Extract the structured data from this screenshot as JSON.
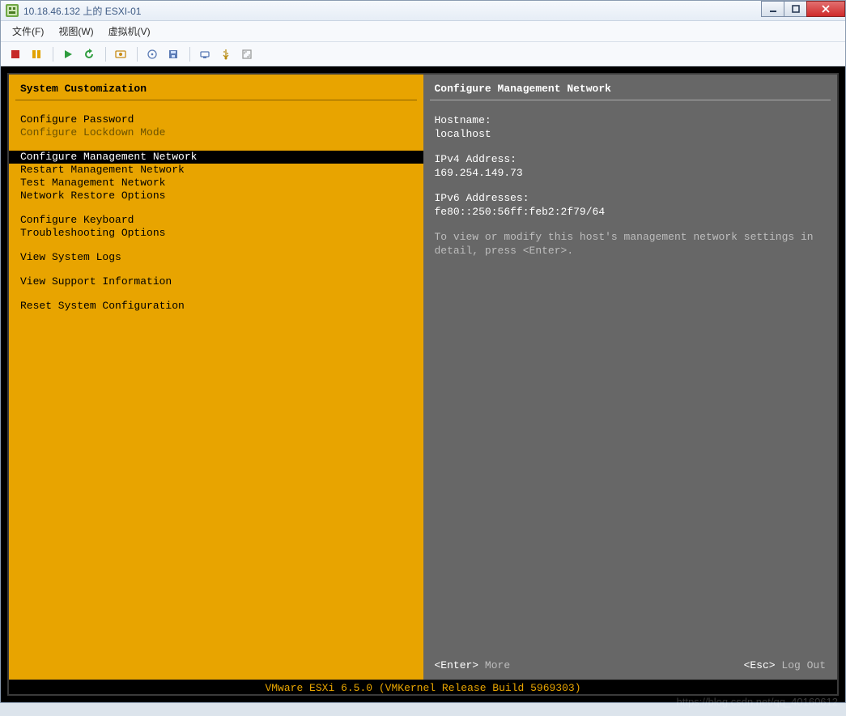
{
  "titlebar": {
    "title": "10.18.46.132 上的 ESXI-01"
  },
  "menubar": {
    "items": [
      "文件(F)",
      "视图(W)",
      "虚拟机(V)"
    ]
  },
  "toolbar": {
    "buttons": [
      "stop-icon",
      "pause-icon",
      "play-icon",
      "refresh-icon",
      "screenshot-icon",
      "cd-icon",
      "floppy-icon",
      "nic-icon",
      "usb-icon",
      "fullscreen-icon"
    ]
  },
  "left": {
    "title": "System Customization",
    "groups": [
      {
        "items": [
          {
            "label": "Configure Password",
            "state": "normal"
          },
          {
            "label": "Configure Lockdown Mode",
            "state": "disabled"
          }
        ]
      },
      {
        "items": [
          {
            "label": "Configure Management Network",
            "state": "selected"
          },
          {
            "label": "Restart Management Network",
            "state": "normal"
          },
          {
            "label": "Test Management Network",
            "state": "normal"
          },
          {
            "label": "Network Restore Options",
            "state": "normal"
          }
        ]
      },
      {
        "items": [
          {
            "label": "Configure Keyboard",
            "state": "normal"
          },
          {
            "label": "Troubleshooting Options",
            "state": "normal"
          }
        ]
      },
      {
        "items": [
          {
            "label": "View System Logs",
            "state": "normal"
          }
        ]
      },
      {
        "items": [
          {
            "label": "View Support Information",
            "state": "normal"
          }
        ]
      },
      {
        "items": [
          {
            "label": "Reset System Configuration",
            "state": "normal"
          }
        ]
      }
    ]
  },
  "right": {
    "title": "Configure Management Network",
    "hostname_label": "Hostname:",
    "hostname_value": "localhost",
    "ipv4_label": "IPv4 Address:",
    "ipv4_value": "169.254.149.73",
    "ipv6_label": "IPv6 Addresses:",
    "ipv6_value": "fe80::250:56ff:feb2:2f79/64",
    "hint": "To view or modify this host's management network settings in detail, press <Enter>."
  },
  "footer": {
    "enter_key": "<Enter>",
    "enter_label": "More",
    "esc_key": "<Esc>",
    "esc_label": "Log Out"
  },
  "buildbar": "VMware ESXi 6.5.0 (VMKernel Release Build 5969303)",
  "watermark": "https://blog.csdn.net/qq_40160612"
}
